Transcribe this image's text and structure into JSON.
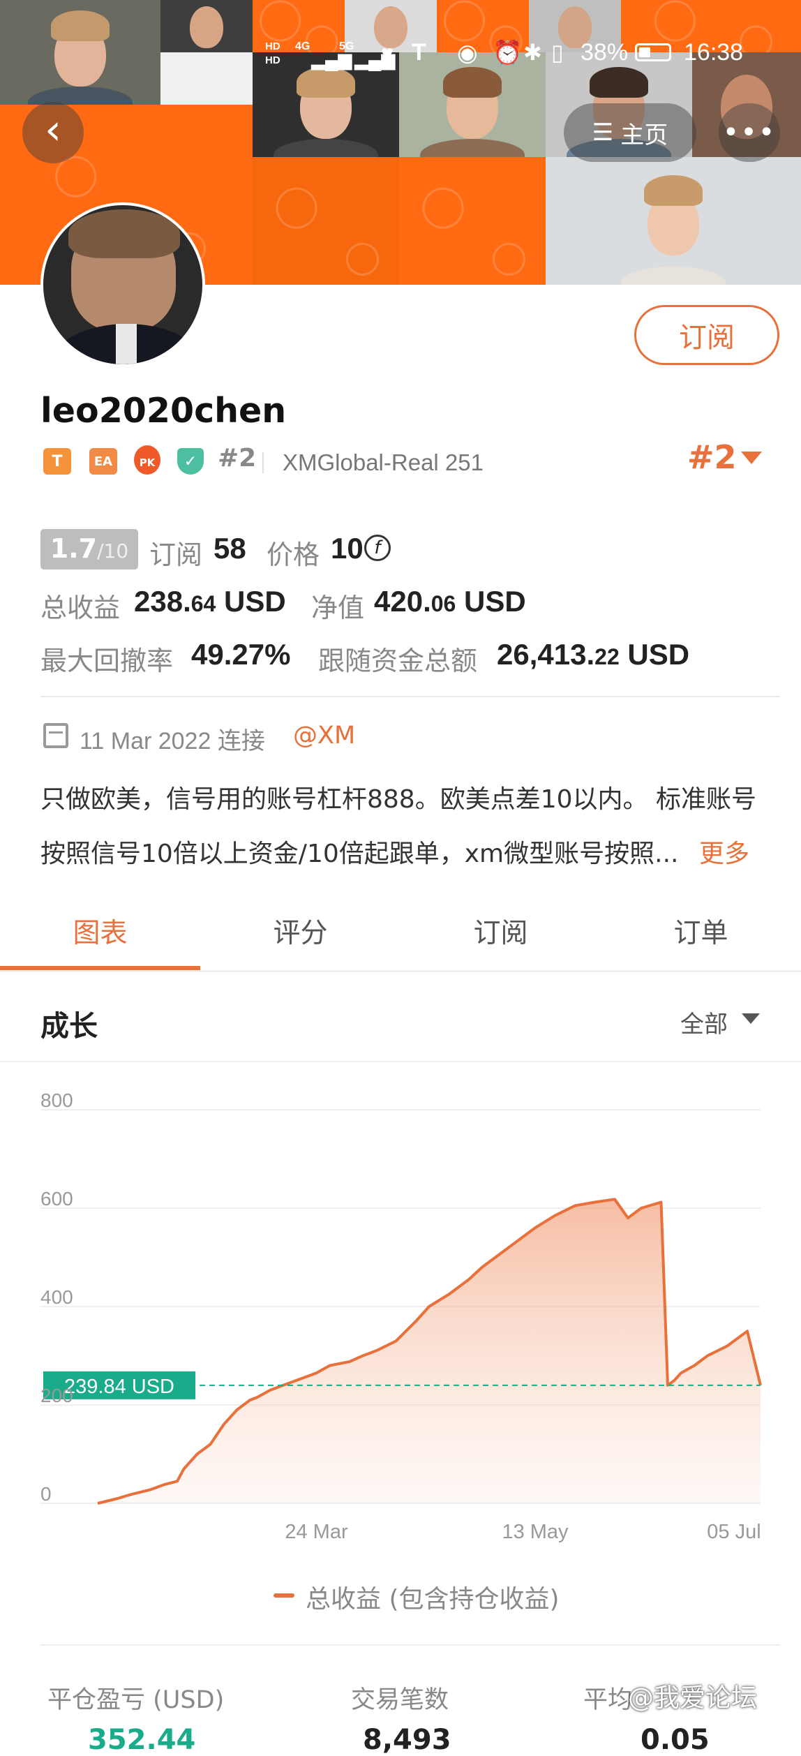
{
  "status_bar": {
    "network_a": "HD",
    "network_b": "HD",
    "signal_1": "4G",
    "signal_2": "5G",
    "battery": "38%",
    "time": "16:38"
  },
  "nav": {
    "back_icon": "chevron-left-icon",
    "home_label": "主页",
    "more_icon": "more-dots-icon"
  },
  "profile": {
    "username": "leo2020chen",
    "subscribe_label": "订阅",
    "badges": [
      "T",
      "EA",
      "PK"
    ],
    "rank_small": "#2",
    "server": "XMGlobal-Real 251",
    "rank_big": "#2"
  },
  "stats": {
    "score": "1.7",
    "score_max": "/10",
    "subscribers_label": "订阅",
    "subscribers": "58",
    "price_label": "价格",
    "price": "10",
    "total_profit_label": "总收益",
    "total_profit_int": "238.",
    "total_profit_dec": "64",
    "total_profit_unit": "USD",
    "equity_label": "净值",
    "equity_int": "420.",
    "equity_dec": "06",
    "equity_unit": "USD",
    "max_drawdown_label": "最大回撤率",
    "max_drawdown": "49.27%",
    "follow_funds_label": "跟随资金总额",
    "follow_funds_int": "26,413.",
    "follow_funds_dec": "22",
    "follow_funds_unit": "USD"
  },
  "connect": {
    "date": "11 Mar 2022 连接",
    "broker": "@XM"
  },
  "description": {
    "line1": "只做欧美，信号用的账号杠杆888。欧美点差10以内。 标准账号",
    "line2": "按照信号10倍以上资金/10倍起跟单，xm微型账号按照...",
    "more": "更多"
  },
  "tabs": [
    "图表",
    "评分",
    "订阅",
    "订单"
  ],
  "growth": {
    "title": "成长",
    "filter": "全部"
  },
  "chart_data": {
    "type": "area",
    "y_ticks": [
      "800",
      "600",
      "400",
      "200",
      "0"
    ],
    "ylim": [
      0,
      800
    ],
    "x_ticks": [
      "24 Mar",
      "13 May",
      "05 Jul"
    ],
    "x_tick_pos": [
      0.33,
      0.66,
      0.96
    ],
    "current_label": "239.84 USD",
    "current_value": 239.84,
    "series": [
      {
        "name": "总收益 (包含持仓收益)",
        "x": [
          0,
          0.03,
          0.05,
          0.08,
          0.1,
          0.12,
          0.13,
          0.15,
          0.17,
          0.19,
          0.21,
          0.23,
          0.24,
          0.26,
          0.28,
          0.31,
          0.33,
          0.35,
          0.38,
          0.4,
          0.42,
          0.45,
          0.48,
          0.5,
          0.53,
          0.56,
          0.58,
          0.6,
          0.63,
          0.66,
          0.69,
          0.72,
          0.75,
          0.78,
          0.8,
          0.81,
          0.82,
          0.85,
          0.86,
          0.87,
          0.88,
          0.9,
          0.92,
          0.95,
          0.97,
          0.98,
          1.0
        ],
        "values": [
          0,
          10,
          18,
          28,
          38,
          45,
          70,
          100,
          120,
          160,
          190,
          210,
          215,
          230,
          240,
          255,
          265,
          280,
          288,
          300,
          310,
          330,
          370,
          400,
          425,
          455,
          480,
          500,
          530,
          560,
          585,
          605,
          612,
          618,
          580,
          590,
          600,
          612,
          240,
          250,
          265,
          280,
          300,
          320,
          340,
          350,
          239.84
        ]
      }
    ],
    "legend": "总收益 (包含持仓收益)"
  },
  "colors": {
    "accent": "#e8703a",
    "current_marker": "#1aab8a"
  },
  "footer": {
    "col1_label": "平仓盈亏 (USD)",
    "col1_value": "352.44",
    "col2_label": "交易笔数",
    "col2_value": "8,493",
    "col3_label": "平均",
    "col3_value": "0.05"
  },
  "watermark": "@我爱论坛"
}
